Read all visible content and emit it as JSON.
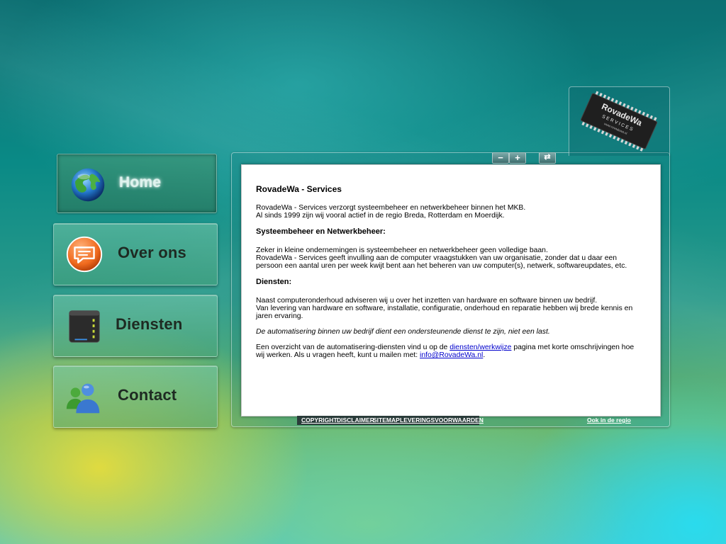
{
  "nav": {
    "home": "Home",
    "over_ons": "Over ons",
    "diensten": "Diensten",
    "contact": "Contact"
  },
  "logo": {
    "line1": "RovadeWa",
    "line2": "SERVICES",
    "line3": "www.rovadewa.nl"
  },
  "toolbar": {
    "minus": "−",
    "plus": "+",
    "refresh": "⇄"
  },
  "content": {
    "title": "RovadeWa - Services",
    "intro_1": "RovadeWa - Services verzorgt systeembeheer en netwerkbeheer binnen het MKB.",
    "intro_2": "Al sinds 1999 zijn wij vooral actief in de regio Breda, Rotterdam en Moerdijk.",
    "h_systeembeheer": "Systeembeheer en Netwerkbeheer:",
    "sys_1": "Zeker in kleine ondernemingen is systeembeheer en netwerkbeheer geen volledige baan.",
    "sys_2": "RovadeWa - Services geeft invulling aan de computer vraagstukken van uw organisatie, zonder dat u daar een persoon een aantal uren per week kwijt bent aan het beheren van uw computer(s), netwerk, softwareupdates, etc.",
    "h_diensten": "Diensten:",
    "dien_1": "Naast computeronderhoud adviseren wij u over het inzetten van hardware en software binnen uw bedrijf.",
    "dien_2": "Van levering van hardware en software, installatie, configuratie, onderhoud en reparatie hebben wij brede kennis en jaren ervaring.",
    "italic": "De automatisering binnen uw bedrijf dient een ondersteunende dienst te zijn, niet een last.",
    "overview_pre": "Een overzicht van de automatisering-diensten vind u op de ",
    "overview_link": "diensten/werkwijze",
    "overview_post": " pagina met korte omschrijvingen hoe wij werken. Als u vragen heeft, kunt u mailen met: ",
    "email_link": "info@RovadeWa.nl",
    "overview_end": "."
  },
  "footer": {
    "copyright": "COPYRIGHT",
    "disclaimer": "DISCLAIMER",
    "sitemap": "SITEMAP",
    "leveringsvoorwaarden": "LEVERINGSVOORWAARDEN",
    "regio": "Ook in de regio"
  },
  "colors": {
    "link": "#0000cc",
    "footer_bar": "#2a3c3a"
  }
}
